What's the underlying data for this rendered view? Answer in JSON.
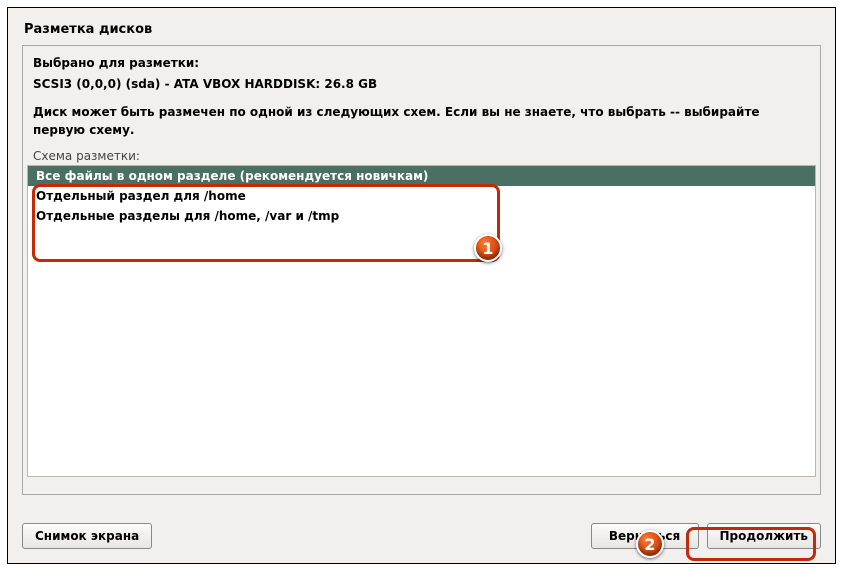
{
  "window": {
    "title": "Разметка дисков"
  },
  "info": {
    "selected_label": "Выбрано для разметки:",
    "disk_line": "SCSI3 (0,0,0) (sda) - ATA VBOX HARDDISK: 26.8 GB",
    "description": "Диск может быть размечен по одной из следующих схем. Если вы не знаете, что выбрать -- выбирайте первую схему."
  },
  "scheme": {
    "label": "Схема разметки:",
    "options": [
      "Все файлы в одном разделе (рекомендуется новичкам)",
      "Отдельный раздел для /home",
      "Отдельные разделы для /home, /var и /tmp"
    ],
    "selected_index": 0
  },
  "buttons": {
    "screenshot": "Снимок экрана",
    "back": "Вернуться",
    "continue": "Продолжить"
  },
  "annotations": {
    "marker1": "1",
    "marker2": "2"
  }
}
